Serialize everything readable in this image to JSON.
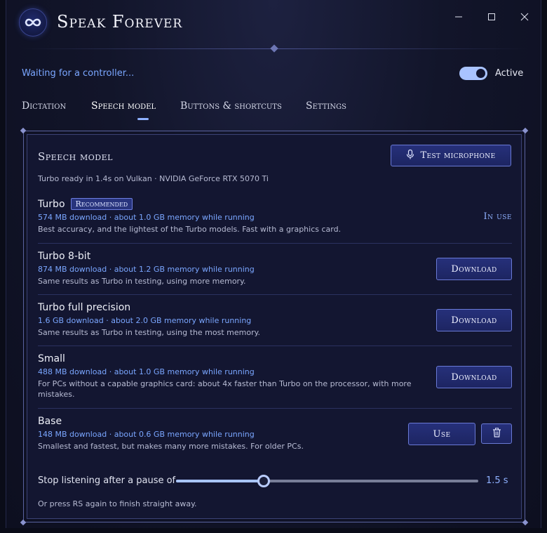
{
  "app": {
    "title": "Speak Forever"
  },
  "window_controls": {
    "minimize": "minimize-icon",
    "maximize": "maximize-icon",
    "close": "close-icon"
  },
  "status": {
    "text": "Waiting for a controller...",
    "toggle_on": true,
    "toggle_label": "Active"
  },
  "tabs": [
    {
      "label": "Dictation",
      "active": false
    },
    {
      "label": "Speech model",
      "active": true
    },
    {
      "label": "Buttons & shortcuts",
      "active": false
    },
    {
      "label": "Settings",
      "active": false
    }
  ],
  "panel": {
    "title": "Speech model",
    "test_button": "Test microphone",
    "test_icon": "microphone-icon",
    "ready_text": "Turbo ready in 1.4s on Vulkan · NVIDIA GeForce RTX 5070 Ti",
    "models": [
      {
        "name": "Turbo",
        "badge": "Recommended",
        "size": "574 MB download · about 1.0 GB memory while running",
        "desc": "Best accuracy, and the lightest of the Turbo models. Fast with a graphics card.",
        "status": "In use"
      },
      {
        "name": "Turbo 8-bit",
        "size": "874 MB download · about 1.2 GB memory while running",
        "desc": "Same results as Turbo in testing, using more memory.",
        "action": "Download"
      },
      {
        "name": "Turbo full precision",
        "size": "1.6 GB download · about 2.0 GB memory while running",
        "desc": "Same results as Turbo in testing, using the most memory.",
        "action": "Download"
      },
      {
        "name": "Small",
        "size": "488 MB download · about 1.0 GB memory while running",
        "desc": "For PCs without a capable graphics card: about 4x faster than Turbo on the processor, with more mistakes.",
        "action": "Download"
      },
      {
        "name": "Base",
        "size": "148 MB download · about 0.6 GB memory while running",
        "desc": "Smallest and fastest, but makes many more mistakes. For older PCs.",
        "action": "Use",
        "delete_icon": "trash-icon"
      }
    ],
    "pause": {
      "label": "Stop listening after a pause of",
      "value_text": "1.5 s",
      "level_fraction": 0.29
    },
    "hint": "Or press RS again to finish straight away."
  }
}
